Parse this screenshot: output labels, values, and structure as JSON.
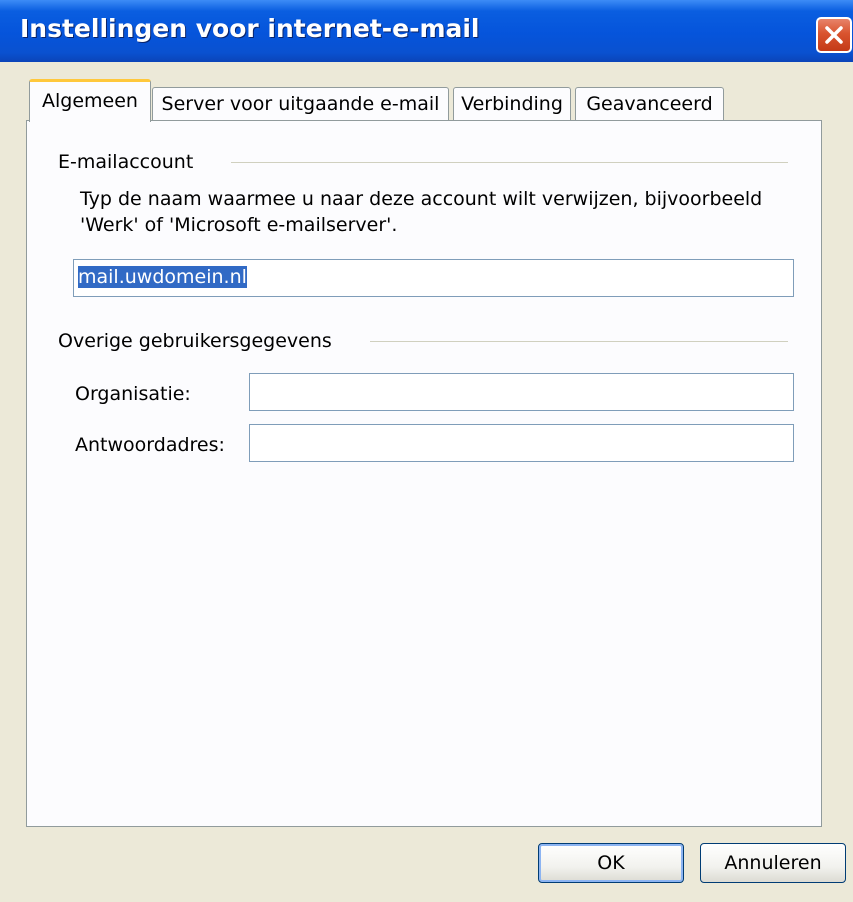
{
  "window": {
    "title": "Instellingen voor internet-e-mail"
  },
  "tabs": [
    {
      "label": "Algemeen"
    },
    {
      "label": "Server voor uitgaande e-mail"
    },
    {
      "label": "Verbinding"
    },
    {
      "label": "Geavanceerd"
    }
  ],
  "email_account": {
    "heading": "E-mailaccount",
    "description": "Typ de naam waarmee u naar deze account wilt verwijzen, bijvoorbeeld 'Werk' of 'Microsoft e-mailserver'.",
    "account_name_value": "mail.uwdomein.nl"
  },
  "user_info": {
    "heading": "Overige gebruikersgegevens",
    "organisation_label": "Organisatie:",
    "organisation_value": "",
    "reply_label": "Antwoordadres:",
    "reply_value": ""
  },
  "buttons": {
    "ok": "OK",
    "cancel": "Annuleren"
  },
  "colors": {
    "title_bar": "#0554db",
    "selection": "#316ac5",
    "active_tab_accent": "#ffc83c"
  }
}
